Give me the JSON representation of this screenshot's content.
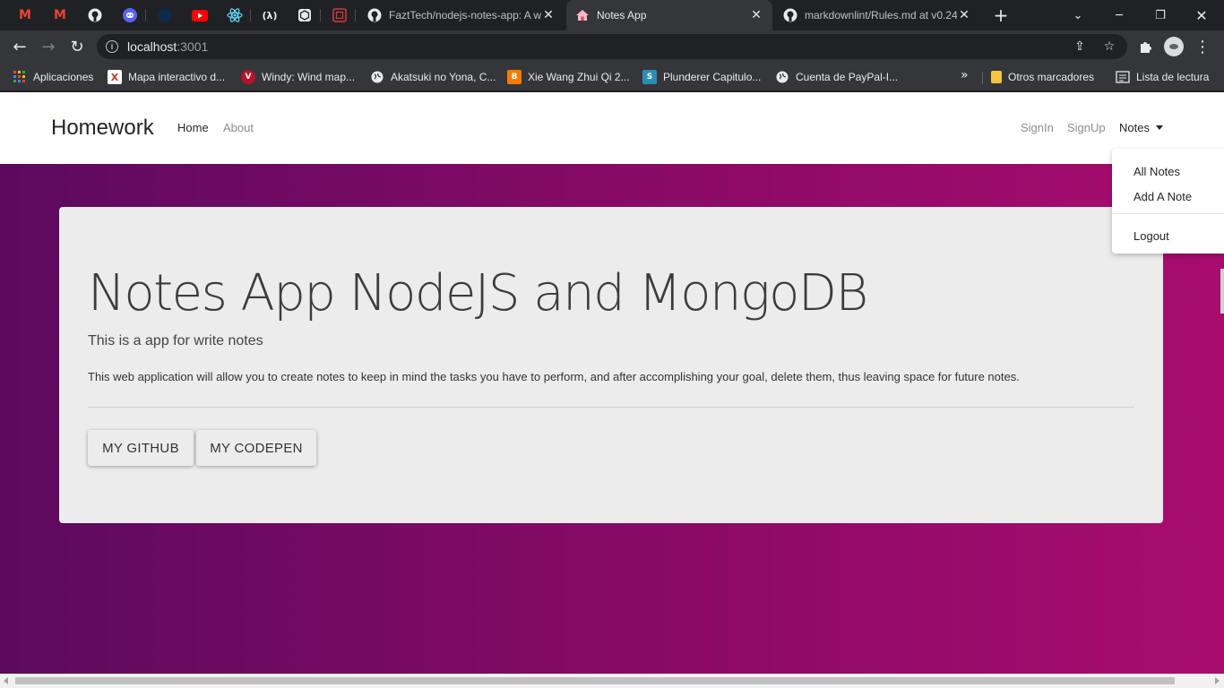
{
  "browser": {
    "pinned_tabs": [
      {
        "icon": "gmail-icon",
        "color": "#ea4335",
        "glyph": "M"
      },
      {
        "icon": "gmail-icon",
        "color": "#ea4335",
        "glyph": "M"
      },
      {
        "icon": "github-icon",
        "color": "#e8eaed",
        "glyph": "◉"
      },
      {
        "icon": "discord-icon",
        "color": "#5865f2",
        "glyph": "◕"
      },
      {
        "icon": "codepen-dark-icon",
        "color": "#0a2a4a",
        "glyph": "●"
      },
      {
        "icon": "youtube-icon",
        "color": "#ff0000",
        "glyph": "▶"
      },
      {
        "icon": "react-icon",
        "color": "#61dafb",
        "glyph": "⚛"
      },
      {
        "icon": "devto-icon",
        "color": "#e8eaed",
        "glyph": "λ"
      },
      {
        "icon": "codesandbox-icon",
        "color": "#e8eaed",
        "glyph": "⬡"
      },
      {
        "icon": "codepen-red-icon",
        "color": "#d13b3b",
        "glyph": "◈"
      }
    ],
    "tabs": [
      {
        "title": "FaztTech/nodejs-notes-app: A w",
        "icon": "github-icon",
        "active": false
      },
      {
        "title": "Notes App",
        "icon": "home-icon",
        "active": true
      },
      {
        "title": "markdownlint/Rules.md at v0.24",
        "icon": "github-icon",
        "active": false
      }
    ],
    "url_host": "localhost",
    "url_port": ":3001",
    "bookmarks": [
      {
        "label": "Aplicaciones",
        "icon": "apps-grid-icon",
        "color": "#4285f4"
      },
      {
        "label": "Mapa interactivo d...",
        "icon": "map-icon",
        "color": "#c0392b"
      },
      {
        "label": "Windy: Wind map...",
        "icon": "windy-icon",
        "color": "#c0392b"
      },
      {
        "label": "Akatsuki no Yona, C...",
        "icon": "globe-icon",
        "color": "#e8eaed"
      },
      {
        "label": "Xie Wang Zhui Qi 2...",
        "icon": "blogger-icon",
        "color": "#f57c00"
      },
      {
        "label": "Plunderer Capitulo...",
        "icon": "s-icon",
        "color": "#2a8db8"
      },
      {
        "label": "Cuenta de PayPal-I...",
        "icon": "globe-icon",
        "color": "#e8eaed"
      }
    ],
    "other_bookmarks": "Otros marcadores",
    "reading_list": "Lista de lectura"
  },
  "page": {
    "navbar": {
      "brand": "Homework",
      "home": "Home",
      "about": "About",
      "signin": "SignIn",
      "signup": "SignUp",
      "notes": "Notes"
    },
    "dropdown": {
      "all_notes": "All Notes",
      "add_note": "Add A Note",
      "logout": "Logout"
    },
    "hero": {
      "title": "Notes App NodeJS and MongoDB",
      "lead": "This is a app for write notes",
      "description": "This web application will allow you to create notes to keep in mind the tasks you have to perform, and after accomplishing your goal, delete them, thus leaving space for future notes.",
      "github_button": "MY GITHUB",
      "codepen_button": "MY CODEPEN"
    }
  }
}
